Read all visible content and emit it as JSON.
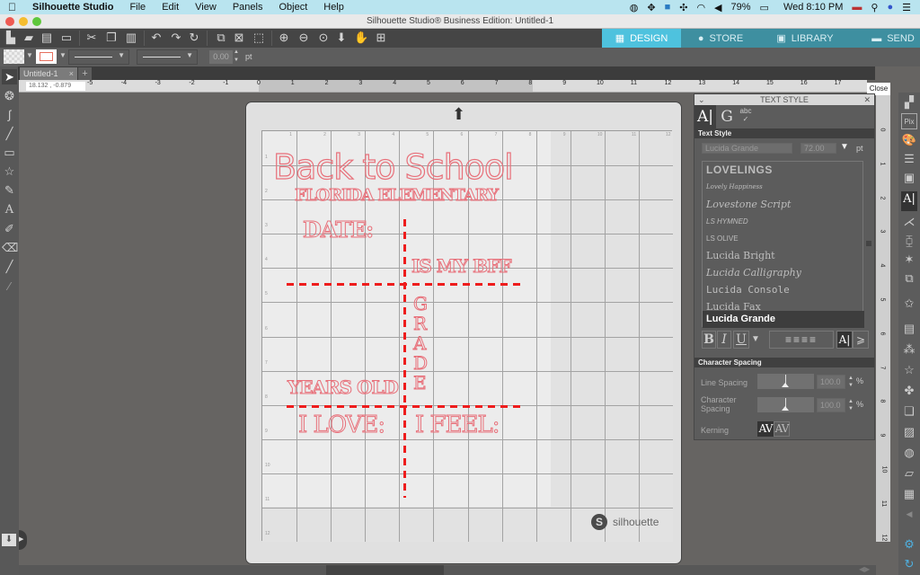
{
  "menubar": {
    "apple_icon": "",
    "app_name": "Silhouette Studio",
    "menus": [
      "File",
      "Edit",
      "View",
      "Panels",
      "Object",
      "Help"
    ],
    "battery": "79%",
    "clock": "Wed 8:10 PM"
  },
  "window": {
    "title": "Silhouette Studio® Business Edition: Untitled-1"
  },
  "toolbar": {
    "icons": [
      "new-document",
      "open-folder",
      "save",
      "print",
      "cut",
      "copy",
      "paste",
      "undo",
      "redo",
      "redraw",
      "group",
      "ungroup",
      "compound",
      "zoom-in",
      "zoom-out",
      "zoom-selection",
      "pan-down",
      "hand",
      "fit-to-page"
    ],
    "nav_tabs": [
      {
        "label": "DESIGN",
        "icon": "grid-icon",
        "active": true
      },
      {
        "label": "STORE",
        "icon": "silhouette-s-icon",
        "active": false
      },
      {
        "label": "LIBRARY",
        "icon": "library-icon",
        "active": false
      },
      {
        "label": "SEND",
        "icon": "cutter-icon",
        "active": false
      }
    ]
  },
  "line_style_bar": {
    "line_width_value": "0.00",
    "line_width_unit": "pt"
  },
  "document_tabs": [
    {
      "label": "Untitled-1",
      "close": "×"
    }
  ],
  "add_tab_label": "+",
  "coordinates": "18.132 , -0.879",
  "ruler_h_ticks": [
    "-5",
    "-4",
    "-3",
    "-2",
    "-1",
    "0",
    "1",
    "2",
    "3",
    "4",
    "5",
    "6",
    "7",
    "8",
    "9",
    "10",
    "11",
    "12",
    "13",
    "14",
    "15",
    "16",
    "17"
  ],
  "ruler_v_ticks": [
    "0",
    "1",
    "2",
    "3",
    "4",
    "5",
    "6",
    "7",
    "8",
    "9",
    "10",
    "11",
    "12"
  ],
  "close_label": "Close",
  "mat": {
    "col_labels": [
      "1",
      "2",
      "3",
      "4",
      "5",
      "6",
      "7",
      "8",
      "9",
      "10",
      "11",
      "12"
    ],
    "row_labels": [
      "1",
      "2",
      "3",
      "4",
      "5",
      "6",
      "7",
      "8",
      "9",
      "10",
      "11",
      "12"
    ],
    "brand": "silhouette",
    "design_texts": {
      "title": "Back to School",
      "school": "FLORIDA ELEMENTARY",
      "date": "DATE:",
      "bff": "IS MY BFF",
      "grade": [
        "G",
        "R",
        "A",
        "D",
        "E"
      ],
      "years": "YEARS OLD",
      "love": "I LOVE:",
      "feel": "I FEEL:"
    },
    "text_color": "#e8707a",
    "dash_color": "#ee1c1c"
  },
  "text_style_panel": {
    "title": "TEXT STYLE",
    "section_text_style": "Text Style",
    "font_name": "Lucida Grande",
    "font_size": "72.00",
    "font_size_unit": "pt",
    "fonts": [
      "LOVELINGS",
      "Lovely Happiness",
      "Lovestone Script",
      "LS HYMNED",
      "LS OLIVE",
      "Lucida Bright",
      "Lucida Calligraphy",
      "Lucida Console",
      "Lucida Fax",
      "Lucida Grande"
    ],
    "selected_font": "Lucida Grande",
    "format_buttons": [
      "B",
      "I",
      "U"
    ],
    "section_char_spacing": "Character Spacing",
    "line_spacing_label": "Line Spacing",
    "line_spacing_value": "100.0",
    "char_spacing_label": "Character Spacing",
    "char_spacing_value": "100.0",
    "percent": "%",
    "kerning_label": "Kerning",
    "kerning_on": "AV",
    "kerning_off": "AV"
  }
}
